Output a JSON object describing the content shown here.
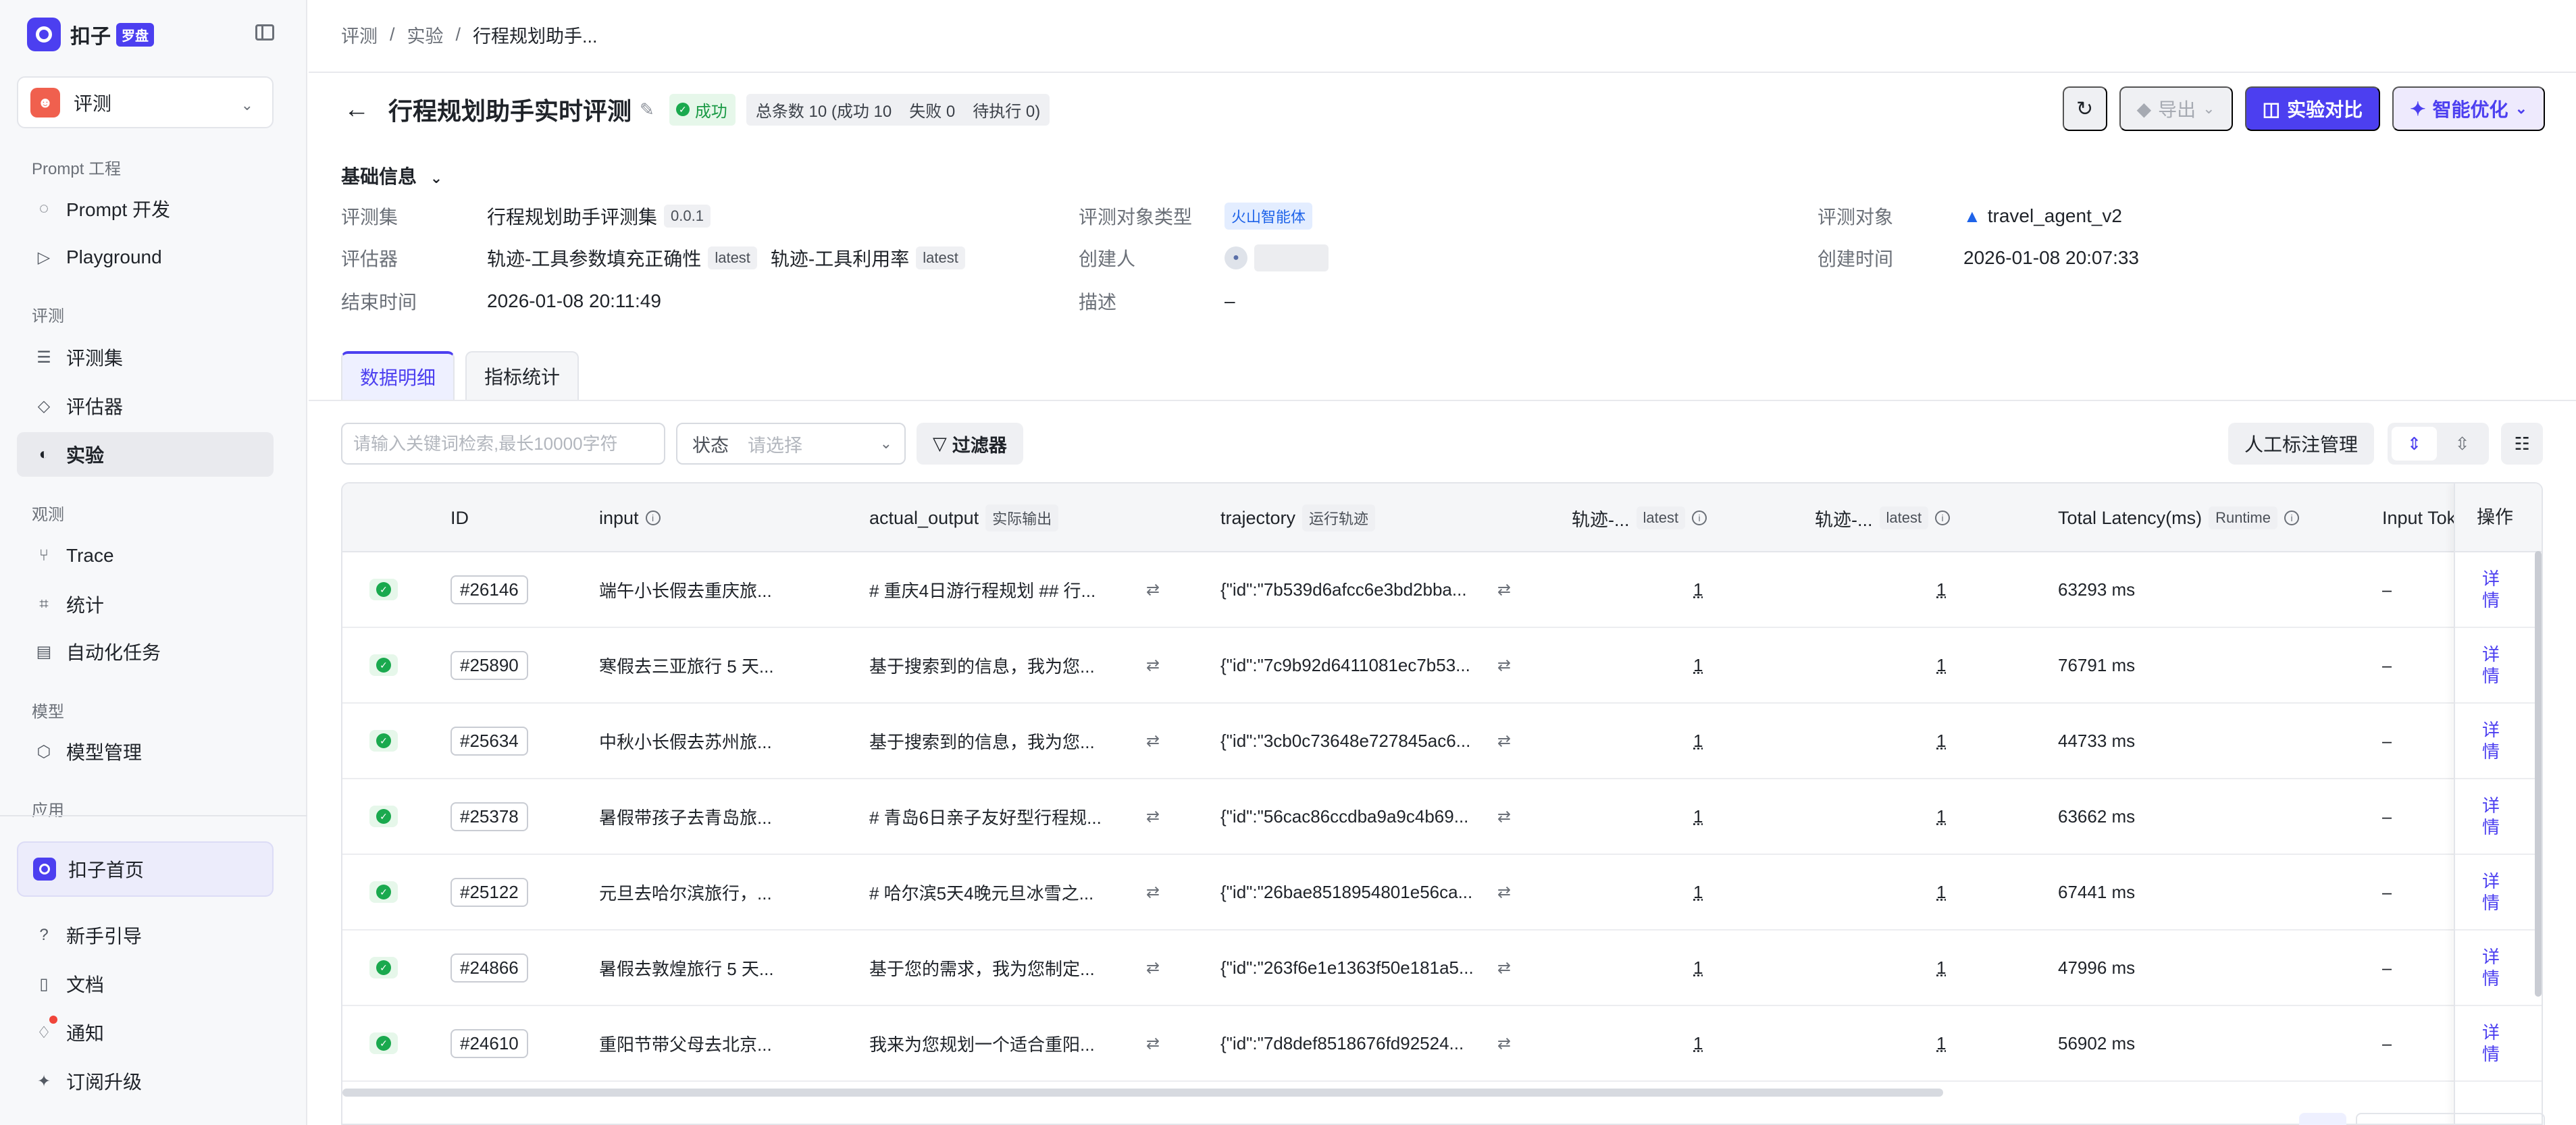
{
  "app": {
    "logo_text": "扣子",
    "logo_badge": "罗盘",
    "space": "评测"
  },
  "sidebar": {
    "sections": {
      "prompt": "Prompt 工程",
      "eval": "评测",
      "observe": "观测",
      "model": "模型",
      "app": "应用"
    },
    "items": [
      {
        "label": "Prompt 开发",
        "icon": "chat-icon"
      },
      {
        "label": "Playground",
        "icon": "play-icon"
      },
      {
        "label": "评测集",
        "icon": "database-icon"
      },
      {
        "label": "评估器",
        "icon": "bulb-icon"
      },
      {
        "label": "实验",
        "icon": "experiment-icon",
        "active": true
      },
      {
        "label": "Trace",
        "icon": "trace-icon"
      },
      {
        "label": "统计",
        "icon": "chart-icon"
      },
      {
        "label": "自动化任务",
        "icon": "task-icon"
      },
      {
        "label": "模型管理",
        "icon": "model-icon"
      }
    ],
    "home": "扣子首页",
    "bottom": [
      {
        "label": "新手引导",
        "icon": "help-icon"
      },
      {
        "label": "文档",
        "icon": "doc-icon"
      },
      {
        "label": "通知",
        "icon": "bell-icon"
      },
      {
        "label": "订阅升级",
        "icon": "upgrade-icon"
      }
    ]
  },
  "breadcrumb": [
    "评测",
    "实验",
    "行程规划助手..."
  ],
  "header": {
    "title": "行程规划助手实时评测",
    "status": "成功",
    "counts": {
      "total": "总条数 10 (成功 10",
      "failed": "失败 0",
      "pending": "待执行 0)"
    },
    "buttons": {
      "export": "导出",
      "compare": "实验对比",
      "optimize": "智能优化"
    }
  },
  "basic_info": {
    "toggle": "基础信息",
    "dataset_key": "评测集",
    "dataset_val": "行程规划助手评测集",
    "dataset_ver": "0.0.1",
    "evaluator_key": "评估器",
    "evaluator_1": "轨迹-工具参数填充正确性",
    "evaluator_1_tag": "latest",
    "evaluator_2": "轨迹-工具利用率",
    "evaluator_2_tag": "latest",
    "end_time_key": "结束时间",
    "end_time_val": "2026-01-08 20:11:49",
    "target_type_key": "评测对象类型",
    "target_type_val": "火山智能体",
    "creator_key": "创建人",
    "desc_key": "描述",
    "desc_val": "–",
    "target_key": "评测对象",
    "target_val": "travel_agent_v2",
    "created_key": "创建时间",
    "created_val": "2026-01-08 20:07:33"
  },
  "tabs": [
    "数据明细",
    "指标统计"
  ],
  "filters": {
    "search_placeholder": "请输入关键词检索,最长10000字符",
    "status_label": "状态",
    "status_placeholder": "请选择",
    "filter_button": "过滤器",
    "annotation_button": "人工标注管理"
  },
  "table": {
    "headers": {
      "id": "ID",
      "input": "input",
      "actual_output": "actual_output",
      "actual_output_tag": "实际输出",
      "trajectory": "trajectory",
      "trajectory_tag": "运行轨迹",
      "eval1": "轨迹-...",
      "eval1_tag": "latest",
      "eval2": "轨迹-...",
      "eval2_tag": "latest",
      "latency": "Total Latency(ms)",
      "latency_tag": "Runtime",
      "input_tokens": "Input Tok",
      "op": "操作"
    },
    "rows": [
      {
        "id": "#26146",
        "input": "端午小长假去重庆旅...",
        "output": "# 重庆4日游行程规划 ## 行...",
        "trajectory": "{\"id\":\"7b539d6afcc6e3bd2bba...",
        "s1": "1",
        "s2": "1",
        "latency": "63293 ms",
        "tokens": "–",
        "op": "详情"
      },
      {
        "id": "#25890",
        "input": "寒假去三亚旅行 5 天...",
        "output": "基于搜索到的信息，我为您...",
        "trajectory": "{\"id\":\"7c9b92d6411081ec7b53...",
        "s1": "1",
        "s2": "1",
        "latency": "76791 ms",
        "tokens": "–",
        "op": "详情"
      },
      {
        "id": "#25634",
        "input": "中秋小长假去苏州旅...",
        "output": "基于搜索到的信息，我为您...",
        "trajectory": "{\"id\":\"3cb0c73648e727845ac6...",
        "s1": "1",
        "s2": "1",
        "latency": "44733 ms",
        "tokens": "–",
        "op": "详情"
      },
      {
        "id": "#25378",
        "input": "暑假带孩子去青岛旅...",
        "output": "# 青岛6日亲子友好型行程规...",
        "trajectory": "{\"id\":\"56cac86ccdba9a9c4b69...",
        "s1": "1",
        "s2": "1",
        "latency": "63662 ms",
        "tokens": "–",
        "op": "详情"
      },
      {
        "id": "#25122",
        "input": "元旦去哈尔滨旅行，...",
        "output": "# 哈尔滨5天4晚元旦冰雪之...",
        "trajectory": "{\"id\":\"26bae8518954801e56ca...",
        "s1": "1",
        "s2": "1",
        "latency": "67441 ms",
        "tokens": "–",
        "op": "详情"
      },
      {
        "id": "#24866",
        "input": "暑假去敦煌旅行 5 天...",
        "output": "基于您的需求，我为您制定...",
        "trajectory": "{\"id\":\"263f6e1e1363f50e181a5...",
        "s1": "1",
        "s2": "1",
        "latency": "47996 ms",
        "tokens": "–",
        "op": "详情"
      },
      {
        "id": "#24610",
        "input": "重阳节带父母去北京...",
        "output": "我来为您规划一个适合重阳...",
        "trajectory": "{\"id\":\"7d8def8518676fd92524...",
        "s1": "1",
        "s2": "1",
        "latency": "56902 ms",
        "tokens": "–",
        "op": "详情"
      }
    ]
  }
}
